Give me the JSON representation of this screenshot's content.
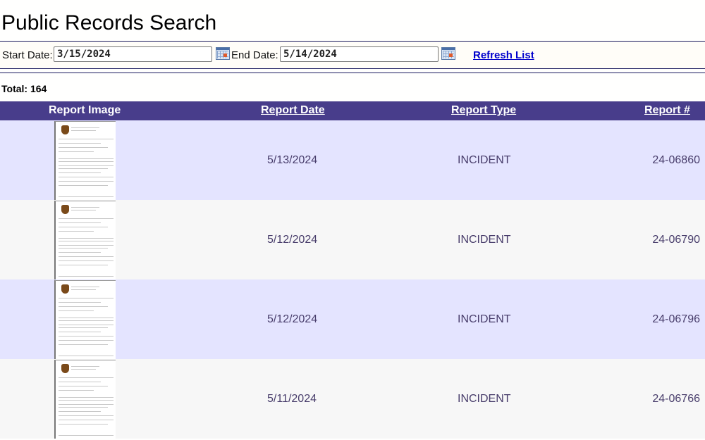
{
  "page": {
    "title": "Public Records Search"
  },
  "filters": {
    "start_label": "Start Date:",
    "start_value": "3/15/2024",
    "end_label": "End Date:",
    "end_value": "5/14/2024",
    "calendar_icon": "calendar-icon",
    "refresh_label": "Refresh List"
  },
  "summary": {
    "total_label": "Total: 164"
  },
  "table": {
    "headers": {
      "image": "Report Image",
      "date": "Report Date",
      "type": "Report Type",
      "number": "Report #"
    },
    "rows": [
      {
        "date": "5/13/2024",
        "type": "INCIDENT",
        "number": "24-06860"
      },
      {
        "date": "5/12/2024",
        "type": "INCIDENT",
        "number": "24-06790"
      },
      {
        "date": "5/12/2024",
        "type": "INCIDENT",
        "number": "24-06796"
      },
      {
        "date": "5/11/2024",
        "type": "INCIDENT",
        "number": "24-06766"
      }
    ]
  },
  "colors": {
    "header_bg": "#483d8b",
    "row_odd": "#e4e4ff",
    "row_even": "#f7f7f7",
    "link": "#0000cc"
  }
}
